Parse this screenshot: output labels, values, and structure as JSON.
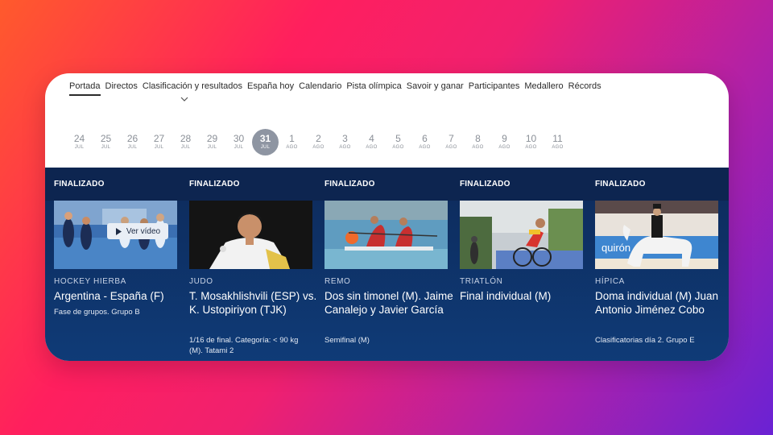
{
  "nav": {
    "items": [
      "Portada",
      "Directos",
      "Clasificación y resultados",
      "España hoy",
      "Calendario",
      "Pista olímpica",
      "Savoir y ganar",
      "Participantes",
      "Medallero",
      "Récords"
    ],
    "active_index": 0
  },
  "dates": [
    {
      "day": "24",
      "month": "JUL"
    },
    {
      "day": "25",
      "month": "JUL"
    },
    {
      "day": "26",
      "month": "JUL"
    },
    {
      "day": "27",
      "month": "JUL"
    },
    {
      "day": "28",
      "month": "JUL"
    },
    {
      "day": "29",
      "month": "JUL"
    },
    {
      "day": "30",
      "month": "JUL"
    },
    {
      "day": "31",
      "month": "JUL"
    },
    {
      "day": "1",
      "month": "AGO"
    },
    {
      "day": "2",
      "month": "AGO"
    },
    {
      "day": "3",
      "month": "AGO"
    },
    {
      "day": "4",
      "month": "AGO"
    },
    {
      "day": "5",
      "month": "AGO"
    },
    {
      "day": "6",
      "month": "AGO"
    },
    {
      "day": "7",
      "month": "AGO"
    },
    {
      "day": "8",
      "month": "AGO"
    },
    {
      "day": "9",
      "month": "AGO"
    },
    {
      "day": "10",
      "month": "AGO"
    },
    {
      "day": "11",
      "month": "AGO"
    }
  ],
  "active_date_index": 7,
  "events": [
    {
      "status": "FINALIZADO",
      "sport": "HOCKEY HIERBA",
      "title": "Argentina - España (F)",
      "subtitle": "Fase de grupos. Grupo B",
      "video_label": "Ver vídeo"
    },
    {
      "status": "FINALIZADO",
      "sport": "JUDO",
      "title": "T. Mosakhlishvili (ESP) vs. K. Ustopiriyon (TJK)",
      "subtitle": "1/16 de final. Categoría: < 90 kg (M). Tatami 2"
    },
    {
      "status": "FINALIZADO",
      "sport": "REMO",
      "title": "Dos sin timonel (M). Jaime Canalejo y Javier García",
      "subtitle": "Semifinal (M)"
    },
    {
      "status": "FINALIZADO",
      "sport": "TRIATLÓN",
      "title": "Final individual (M)",
      "subtitle": ""
    },
    {
      "status": "FINALIZADO",
      "sport": "HÍPICA",
      "title": "Doma individual (M) Juan Antonio Jiménez Cobo",
      "subtitle": "Clasificatorias día 2. Grupo E",
      "thumb_sign": "quirón"
    }
  ],
  "colors": {
    "band_top": "#0d2550",
    "band_bottom": "#0f3b77",
    "active_date": "#8e95a2"
  }
}
